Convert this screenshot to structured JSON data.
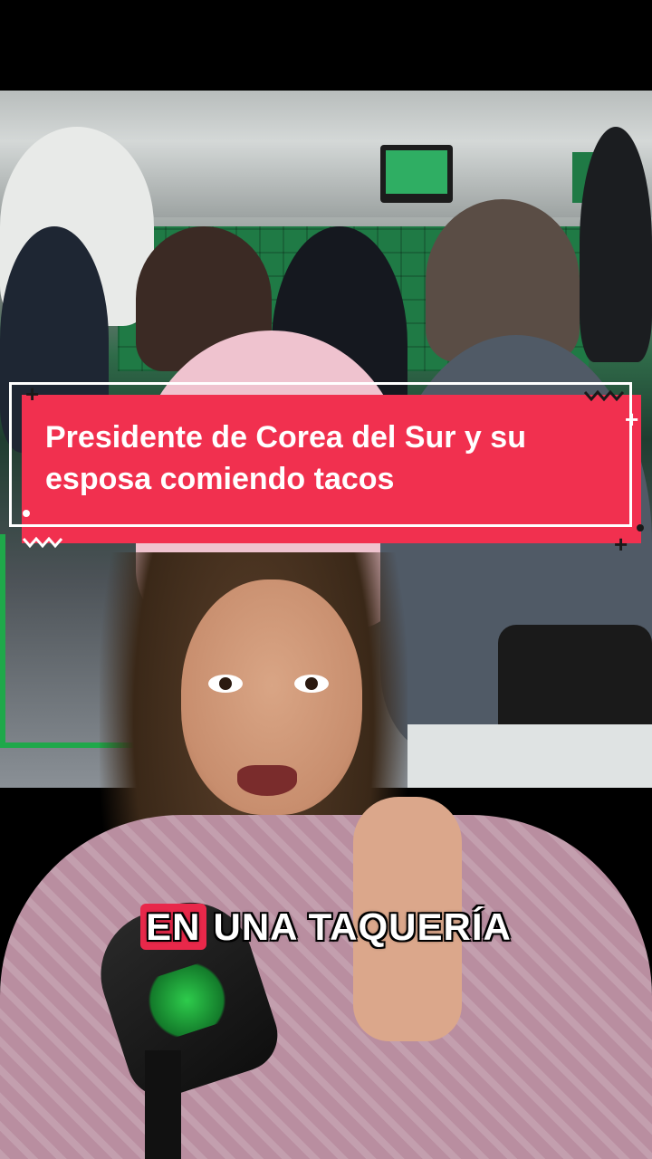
{
  "headline": {
    "line1": "Presidente de Corea del Sur y su",
    "line2": "esposa comiendo tacos"
  },
  "caption": {
    "highlight": "EN",
    "rest": "UNA TAQUERÍA"
  },
  "colors": {
    "banner_red": "#f1304f",
    "caption_highlight": "#e8284a",
    "background": "#000000"
  },
  "icons": {
    "decor_plus": "+",
    "decor_zigzag": "zigzag",
    "decor_dot": "dot"
  }
}
